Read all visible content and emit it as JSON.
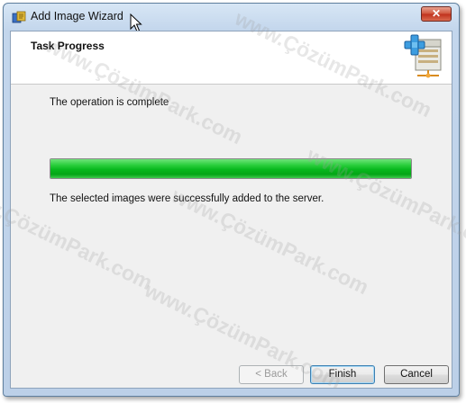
{
  "window": {
    "title": "Add Image Wizard",
    "close_glyph": "✕"
  },
  "header": {
    "title": "Task Progress",
    "icon": "server-add-icon"
  },
  "content": {
    "status_text": "The operation is complete",
    "result_text": "The selected images were successfully added to the server.",
    "progress_fraction": 1.0
  },
  "buttons": {
    "back": "< Back",
    "finish": "Finish",
    "cancel": "Cancel"
  },
  "watermark_text": "www.ÇözümPark.com",
  "colors": {
    "progress_green": "#08b81d",
    "close_red": "#c0301c",
    "title_bar": "#c3d6ec"
  }
}
